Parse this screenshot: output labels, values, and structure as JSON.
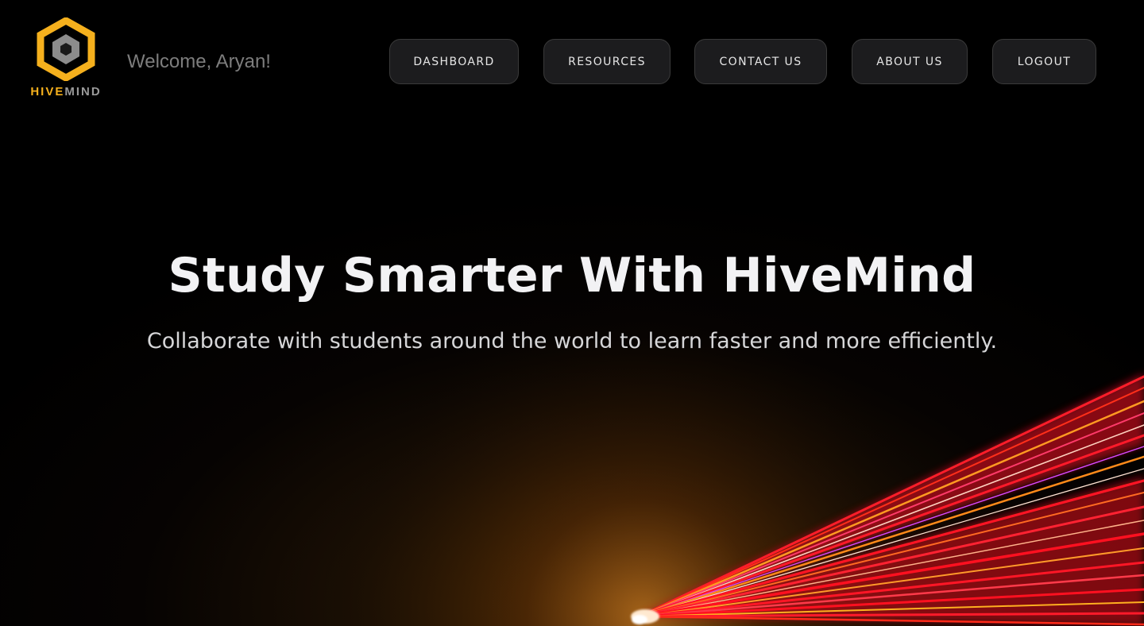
{
  "header": {
    "logo": {
      "icon": "hexagon-logo-icon",
      "text_part1": "HIVE",
      "text_part2": "MIND",
      "accent_color": "#f5b01d"
    },
    "welcome_text": "Welcome, Aryan!"
  },
  "nav": {
    "items": [
      {
        "label": "DASHBOARD"
      },
      {
        "label": "RESOURCES"
      },
      {
        "label": "CONTACT US"
      },
      {
        "label": "ABOUT US"
      },
      {
        "label": "LOGOUT"
      }
    ]
  },
  "hero": {
    "title": "Study Smarter With HiveMind",
    "subtitle": "Collaborate with students around the world to learn faster and more efficiently."
  },
  "colors": {
    "background": "#000000",
    "nav_button_bg": "#1c1c1e",
    "light_streak_red": "#ff1a2a",
    "light_streak_orange": "#ff8a1a"
  }
}
